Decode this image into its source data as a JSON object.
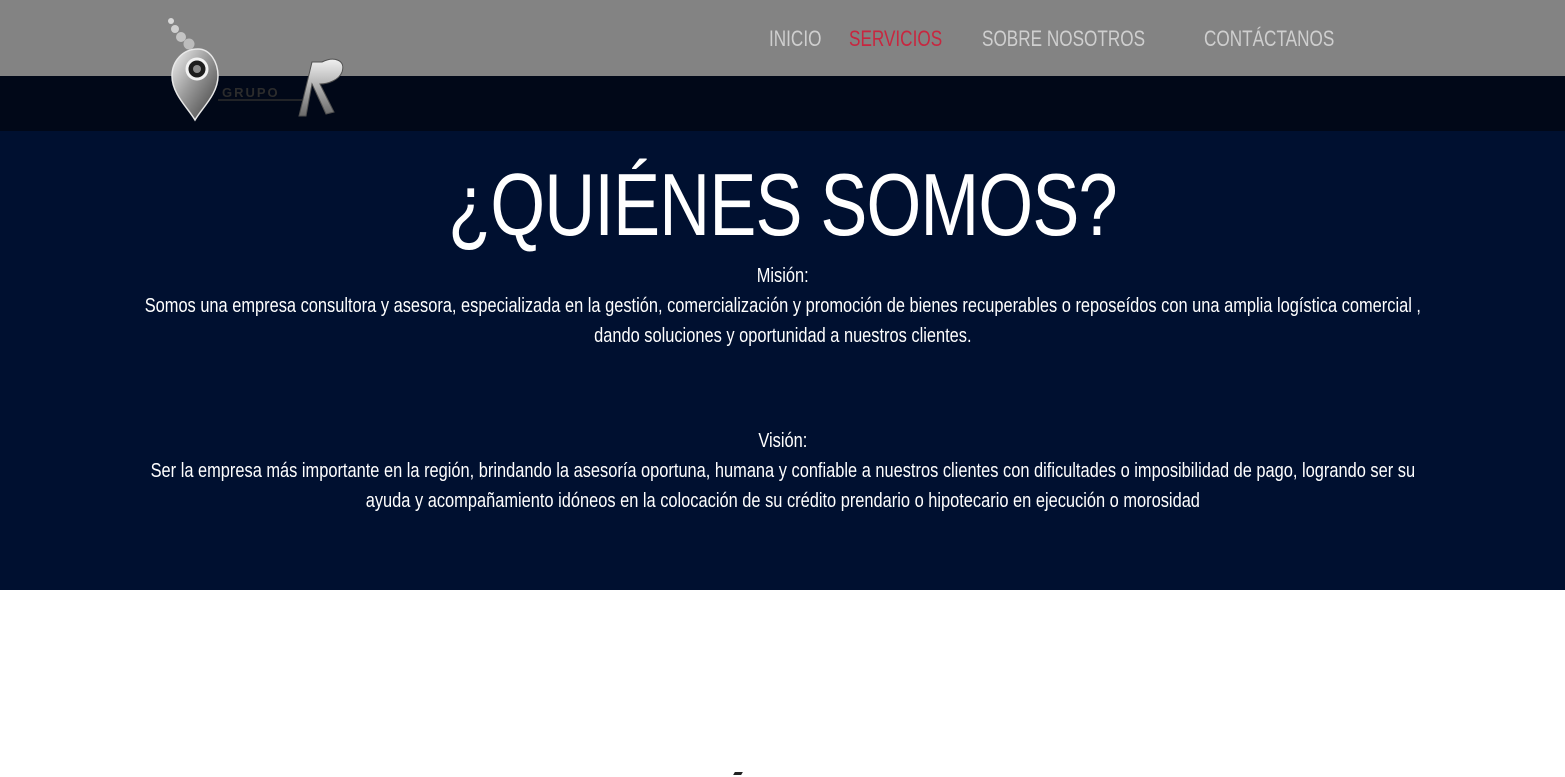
{
  "header": {
    "logo_text": "GRUPO",
    "logo_letter": "R",
    "nav": [
      {
        "label": "INICIO",
        "active": false
      },
      {
        "label": "SERVICIOS",
        "active": true
      },
      {
        "label": "SOBRE NOSOTROS",
        "active": false
      },
      {
        "label": "CONTÁCTANOS",
        "active": false
      }
    ]
  },
  "about": {
    "title": "¿QUIÉNES SOMOS?",
    "mission_heading": "Misión:",
    "mission_text": "Somos una empresa consultora y asesora, especializada en la gestión, comercialización y promoción de bienes recuperables o reposeídos con una amplia logística comercial , dando soluciones y oportunidad a nuestros clientes.",
    "vision_heading": "Visión:",
    "vision_text": "Ser la empresa más importante en la región, brindando la asesoría oportuna, humana y confiable a nuestros clientes con dificultades o imposibilidad de pago, logrando ser su ayuda y acompañamiento idóneos en la colocación de su crédito prendario o hipotecario en ejecución o morosidad"
  },
  "colors": {
    "topbar": "#838383",
    "darkband": "#010818",
    "hero_bg": "#001030",
    "nav_text": "#cfcfcf",
    "nav_active": "#c8263f"
  }
}
